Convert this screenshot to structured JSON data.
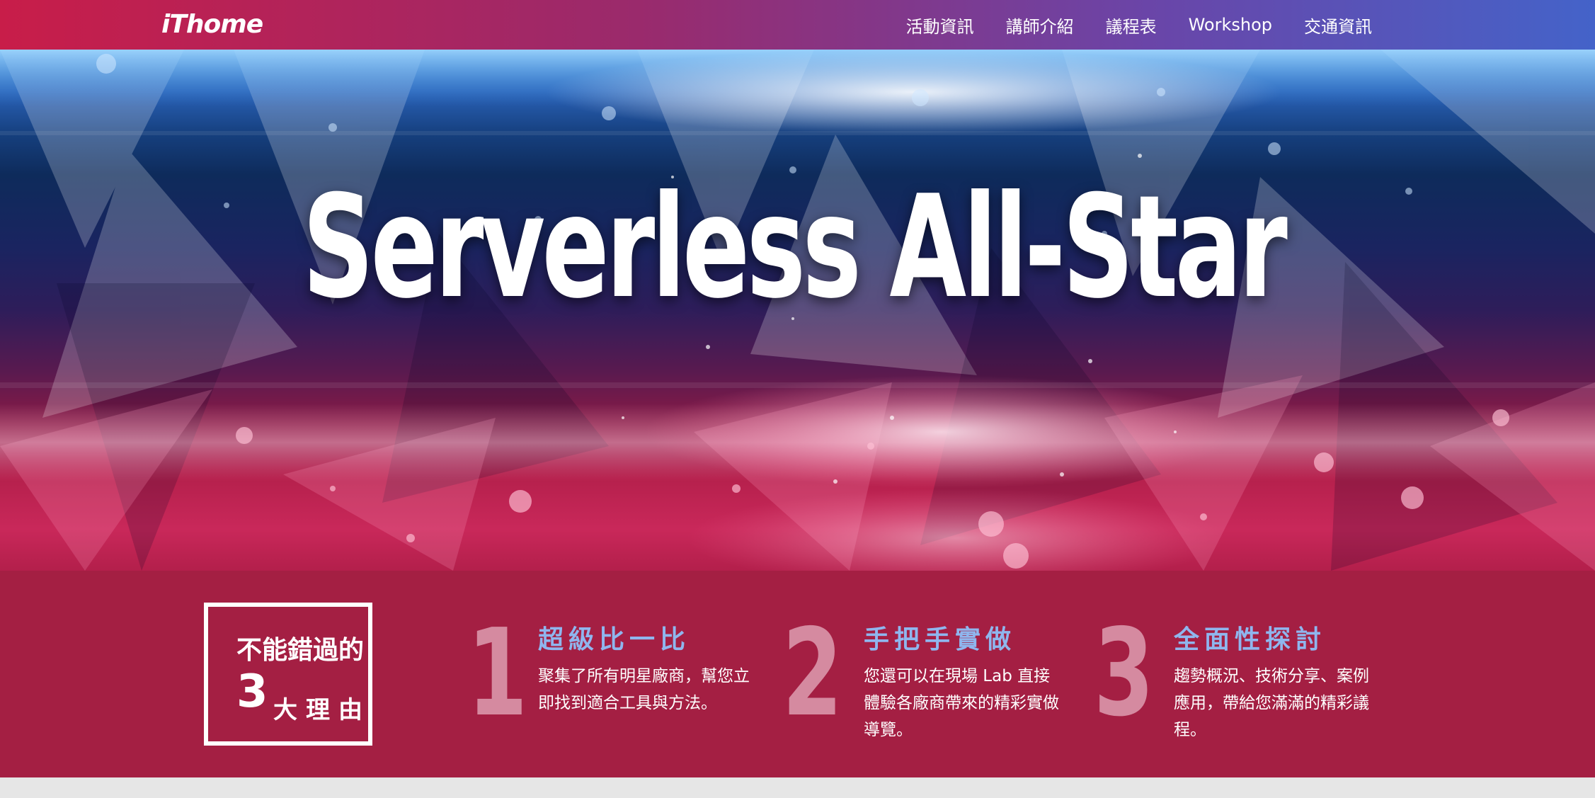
{
  "brand": {
    "logo_text": "iThome"
  },
  "nav": {
    "items": [
      {
        "label": "活動資訊"
      },
      {
        "label": "講師介紹"
      },
      {
        "label": "議程表"
      },
      {
        "label": "Workshop"
      },
      {
        "label": "交通資訊"
      }
    ]
  },
  "hero": {
    "title": "Serverless All-Star"
  },
  "reasons": {
    "badge_line1": "不能錯過的",
    "badge_number": "3",
    "badge_text": "大理由",
    "items": [
      {
        "number": "1",
        "title": "超級比一比",
        "description": "聚集了所有明星廠商，幫您立即找到適合工具與方法。"
      },
      {
        "number": "2",
        "title": "手把手實做",
        "description": "您還可以在現場 Lab 直接體驗各廠商帶來的精彩實做導覽。"
      },
      {
        "number": "3",
        "title": "全面性探討",
        "description": "趨勢概況、技術分享、案例應用，帶給您滿滿的精彩議程。"
      }
    ]
  },
  "colors": {
    "nav_gradient_start": "#c81d49",
    "nav_gradient_end": "#4463c9",
    "reasons_background": "#a41f43",
    "reason_title": "#8fb6ee",
    "reason_number": "#d58aa0"
  }
}
